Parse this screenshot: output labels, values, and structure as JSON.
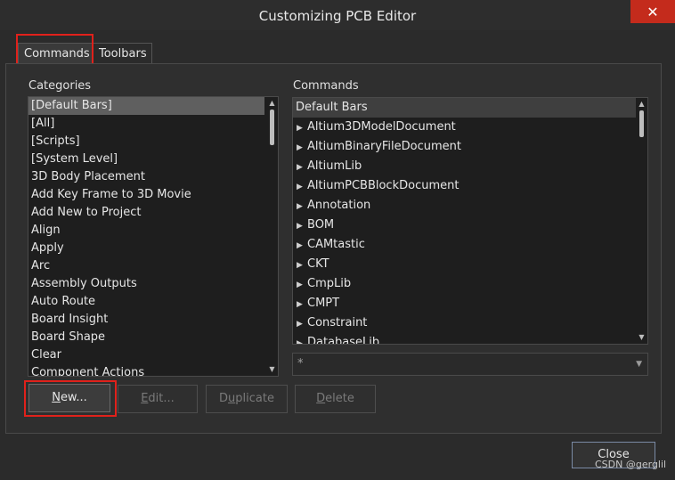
{
  "window": {
    "title": "Customizing PCB Editor",
    "close_glyph": "✕"
  },
  "tabs": [
    {
      "label": "Commands"
    },
    {
      "label": "Toolbars"
    }
  ],
  "categories": {
    "label": "Categories",
    "items": [
      "[Default Bars]",
      "[All]",
      "[Scripts]",
      "[System Level]",
      "3D Body Placement",
      "Add Key Frame to 3D Movie",
      "Add New to Project",
      "Align",
      "Apply",
      "Arc",
      "Assembly Outputs",
      "Auto Route",
      "Board Insight",
      "Board Shape",
      "Clear",
      "Component Actions"
    ],
    "selected_index": 0
  },
  "commands": {
    "label": "Commands",
    "header": "Default Bars",
    "items": [
      "Altium3DModelDocument",
      "AltiumBinaryFileDocument",
      "AltiumLib",
      "AltiumPCBBlockDocument",
      "Annotation",
      "BOM",
      "CAMtastic",
      "CKT",
      "CmpLib",
      "CMPT",
      "Constraint",
      "DatabaseLib"
    ]
  },
  "filter": {
    "value": "*"
  },
  "buttons": {
    "new": {
      "pre": "",
      "key": "N",
      "post": "ew..."
    },
    "edit": {
      "pre": "",
      "key": "E",
      "post": "dit..."
    },
    "duplicate": {
      "pre": "D",
      "key": "u",
      "post": "plicate"
    },
    "delete": {
      "pre": "",
      "key": "D",
      "post": "elete"
    },
    "close": "Close"
  },
  "watermark": "CSDN @gerglil",
  "colors": {
    "highlight_box": "#e0211b",
    "selected_row": "#5f5f5f",
    "window_close": "#c42b1c"
  }
}
